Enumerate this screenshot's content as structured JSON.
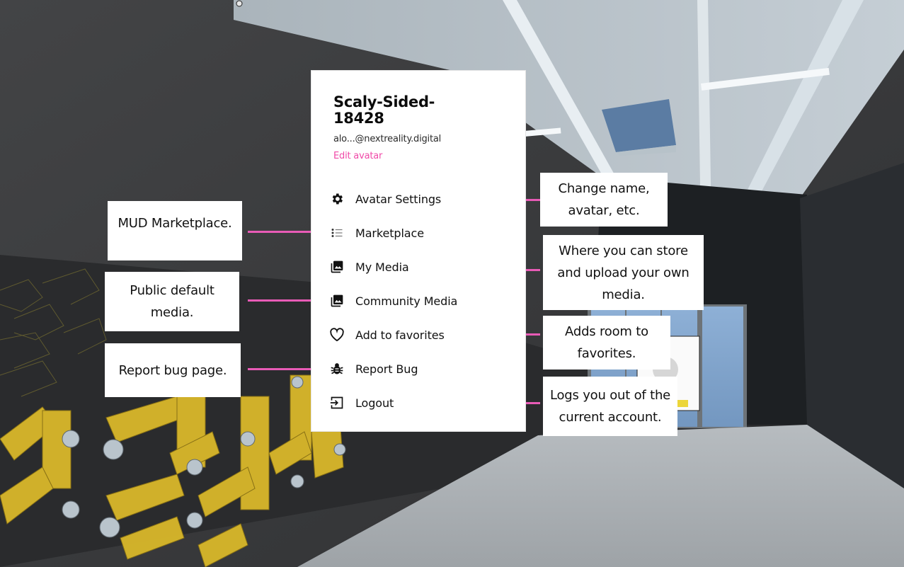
{
  "account_menu": {
    "display_name": "Scaly-Sided-18428",
    "email": "alo...@nextreality.digital",
    "edit_avatar_label": "Edit avatar",
    "items": [
      {
        "label": "Avatar Settings",
        "icon": "gear-icon"
      },
      {
        "label": "Marketplace",
        "icon": "list-icon"
      },
      {
        "label": "My Media",
        "icon": "media-library-icon"
      },
      {
        "label": "Community Media",
        "icon": "media-library-icon"
      },
      {
        "label": "Add to favorites",
        "icon": "heart-outline-icon"
      },
      {
        "label": "Report Bug",
        "icon": "bug-icon"
      },
      {
        "label": "Logout",
        "icon": "logout-icon"
      }
    ]
  },
  "annotations": {
    "left": [
      {
        "text": "MUD Marketplace.",
        "target": "Marketplace"
      },
      {
        "text": "Public default media.",
        "target": "Community Media"
      },
      {
        "text": "Report bug page.",
        "target": "Report Bug"
      }
    ],
    "right": [
      {
        "text": "Change name, avatar, etc.",
        "target": "Avatar Settings"
      },
      {
        "text": "Where you can store and upload your own media.",
        "target": "My Media"
      },
      {
        "text": "Adds room to favorites.",
        "target": "Add to favorites"
      },
      {
        "text": "Logs you out of the current account.",
        "target": "Logout"
      }
    ]
  },
  "colors": {
    "accent_pink": "#e85bb6",
    "edit_link": "#f04aa8",
    "menu_bg": "#ffffff"
  }
}
